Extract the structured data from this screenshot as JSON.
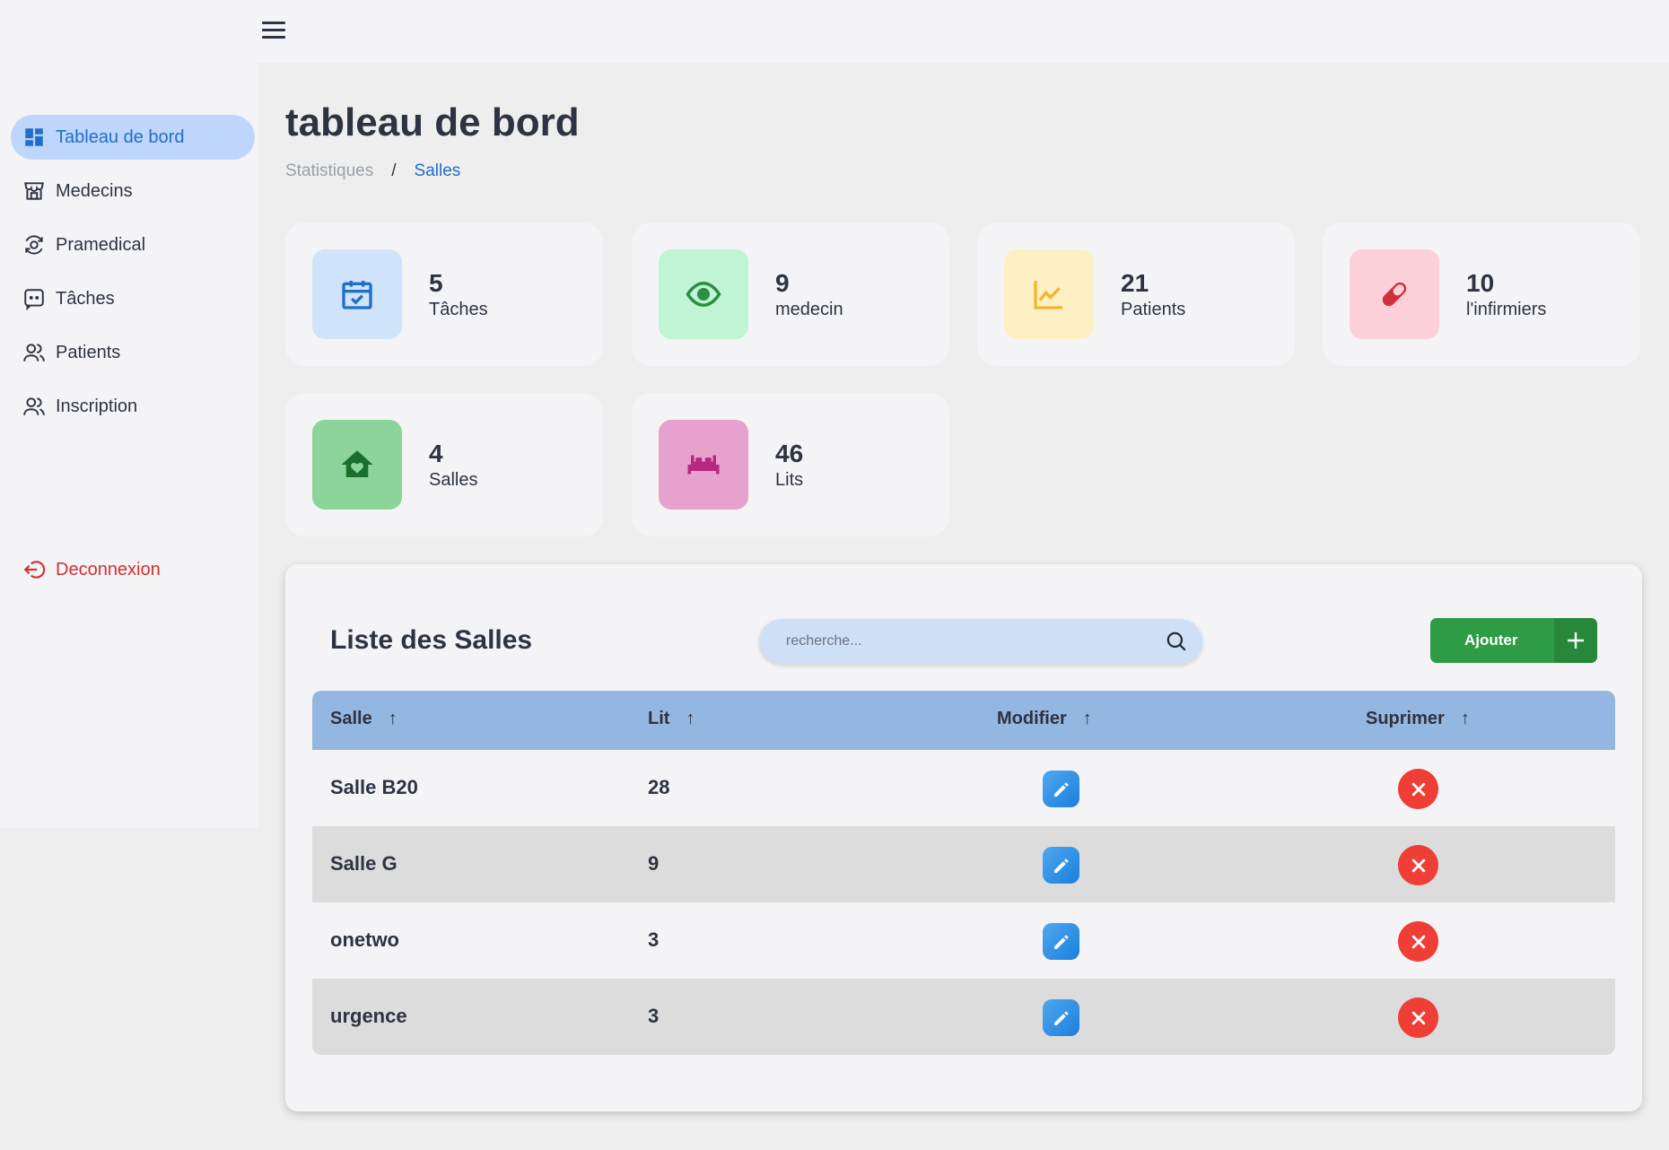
{
  "sidebar": {
    "items": [
      {
        "label": "Tableau de bord",
        "icon": "dashboard-icon"
      },
      {
        "label": "Medecins",
        "icon": "storefront-icon"
      },
      {
        "label": "Pramedical",
        "icon": "medical-icon"
      },
      {
        "label": "Tâches",
        "icon": "chat-icon"
      },
      {
        "label": "Patients",
        "icon": "people-icon"
      },
      {
        "label": "Inscription",
        "icon": "people-icon"
      }
    ],
    "logout_label": "Deconnexion"
  },
  "header": {
    "title": "tableau de bord",
    "breadcrumb": [
      "Statistiques",
      "/",
      "Salles"
    ]
  },
  "stats": [
    {
      "value": "5",
      "label": "Tâches",
      "icon": "calendar-check-icon",
      "tile_color": "#cfe4fb",
      "icon_color": "#1f6fc9"
    },
    {
      "value": "9",
      "label": "medecin",
      "icon": "eye-icon",
      "tile_color": "#bff5d4",
      "icon_color": "#2e8b45"
    },
    {
      "value": "21",
      "label": "Patients",
      "icon": "chart-line-icon",
      "tile_color": "#fdf1c4",
      "icon_color": "#f2b531"
    },
    {
      "value": "10",
      "label": "l'infirmiers",
      "icon": "pill-icon",
      "tile_color": "#fcd0d8",
      "icon_color": "#d0303a"
    },
    {
      "value": "4",
      "label": "Salles",
      "icon": "house-heart-icon",
      "tile_color": "#8cd499",
      "icon_color": "#1b6e2c"
    },
    {
      "value": "46",
      "label": "Lits",
      "icon": "bed-icon",
      "tile_color": "#e6a1cc",
      "icon_color": "#b9277e"
    }
  ],
  "panel": {
    "title": "Liste des Salles",
    "search_placeholder": "recherche...",
    "add_label": "Ajouter"
  },
  "table": {
    "columns": [
      "Salle",
      "Lit",
      "Modifier",
      "Suprimer"
    ],
    "sort_arrow": "↑",
    "rows": [
      {
        "salle": "Salle B20",
        "lit": "28"
      },
      {
        "salle": "Salle G",
        "lit": "9"
      },
      {
        "salle": "onetwo",
        "lit": "3"
      },
      {
        "salle": "urgence",
        "lit": "3"
      }
    ]
  },
  "colors": {
    "accent": "#1f6fc9",
    "add_button": "#2e9c45",
    "delete": "#ef3e35",
    "edit": "#1a7fdc",
    "table_header": "#94b7e2",
    "logout": "#d32f2f"
  }
}
